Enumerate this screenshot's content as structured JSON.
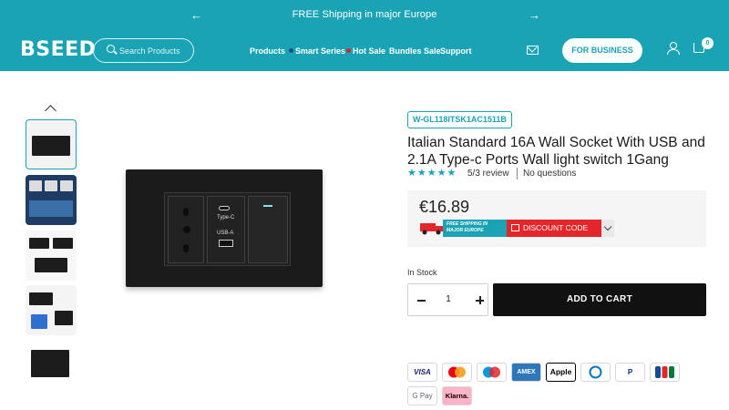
{
  "announcement": {
    "message": "FREE Shipping in major Europe",
    "prev_icon": "arrow-left-icon",
    "next_icon": "arrow-right-icon"
  },
  "header": {
    "logo": "BSEED",
    "search_placeholder": "Search Products",
    "nav": [
      "Products",
      "Smart Series",
      "Hot Sale",
      "Bundles Sale",
      "Support"
    ],
    "nav_dot_colors": {
      "Smart Series": "#1d4f8a",
      "Hot Sale": "#e02424"
    },
    "business_button": "FOR BUSINESS",
    "cart_count": "0",
    "colors": {
      "brand": "#1aa3b4",
      "text": "#ffffff"
    }
  },
  "gallery": {
    "thumbnail_count": 5,
    "active_index": 0
  },
  "main_image": {
    "usb_c_label": "Type-C",
    "usb_a_label": "USB-A"
  },
  "product": {
    "sku": "W-GL118ITSK1AC1511B",
    "title": "Italian Standard 16A Wall Socket With USB and 2.1A Type-c Ports Wall light switch 1Gang",
    "rating_stars": "★★★★★",
    "rating": 5,
    "review_text": "5/3 review",
    "questions_text": "No questions",
    "price": "€16.89",
    "promo_shipping": "FREE SHIPPING IN MAJOR EUROPE",
    "promo_discount": "DISCOUNT CODE",
    "stock": "In Stock",
    "quantity": "1",
    "add_to_cart": "ADD TO CART"
  },
  "payments": [
    "VISA",
    "Mastercard",
    "Maestro",
    "AMEX",
    "Apple Pay",
    "Diners",
    "PayPal",
    "JCB",
    "G Pay",
    "Klarna."
  ]
}
